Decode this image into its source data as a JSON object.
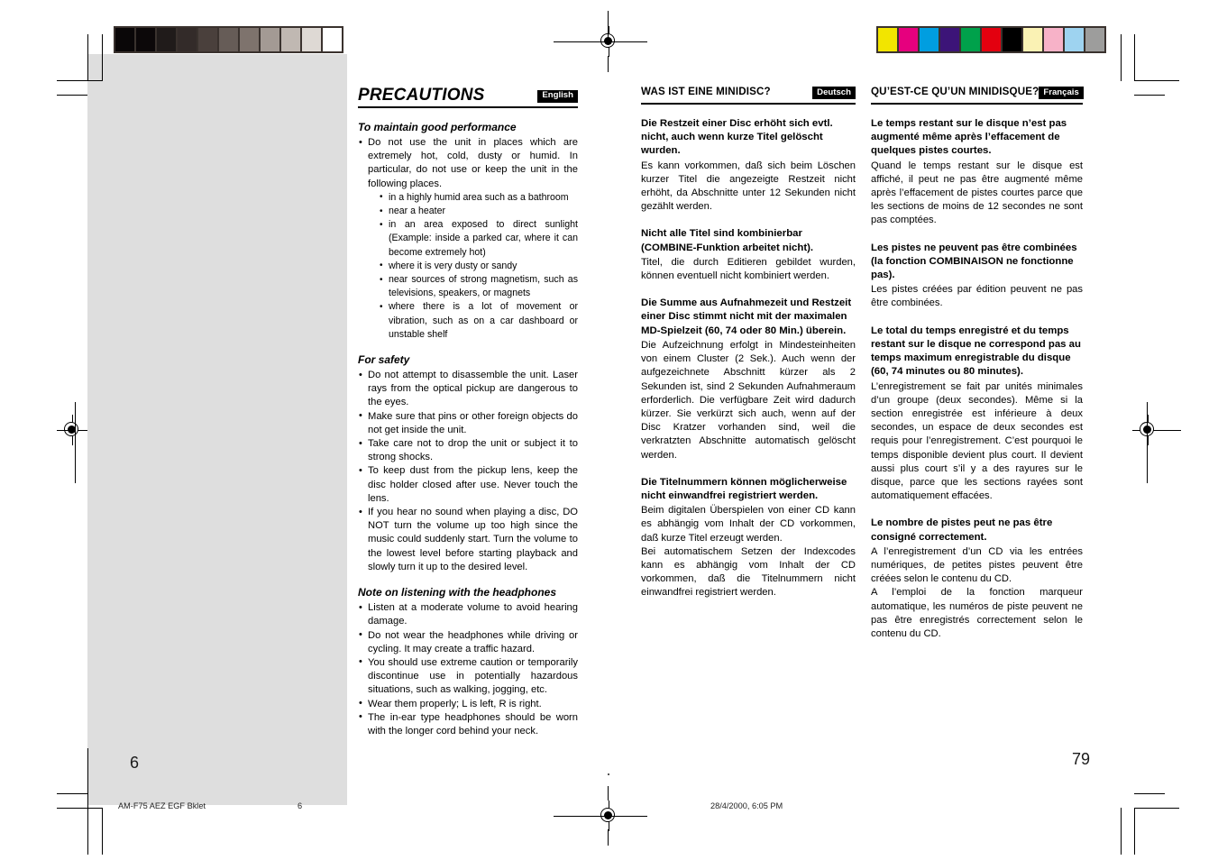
{
  "document": {
    "folio_left": "6",
    "folio_right": "79",
    "slug_name": "AM-F75 AEZ EGF Bklet",
    "slug_page": "6",
    "slug_date": "28/4/2000, 6:05 PM"
  },
  "colorbars": {
    "grayscale": [
      "#0a0708",
      "#0c0809",
      "#201b1a",
      "#332b29",
      "#4a403c",
      "#665c57",
      "#7e736d",
      "#a39a94",
      "#c0b8b2",
      "#ded9d4",
      "#ffffff"
    ],
    "process": [
      "#f2e500",
      "#e6007e",
      "#009ee0",
      "#3c1478",
      "#00a14b",
      "#e3000f",
      "#000000",
      "#faf2b4",
      "#f7b2c8",
      "#9ed3f0",
      "#9d9d9c"
    ]
  },
  "english": {
    "lang_tag": "English",
    "title": "PRECAUTIONS",
    "sections": [
      {
        "heading": "To maintain good performance",
        "items": [
          {
            "text": "Do not use the unit in places which are extremely hot, cold, dusty or humid.  In particular, do not use or keep the unit in the following places.",
            "subitems": [
              "in a highly humid area such as a bathroom",
              "near a heater",
              "in an area exposed to direct sunlight (Example: inside a parked car, where it can become extremely hot)",
              "where it is very dusty or sandy",
              "near sources of strong magnetism, such as televisions, speakers, or magnets",
              "where there is a lot of movement or vibration, such as on a car dashboard or unstable shelf"
            ]
          }
        ]
      },
      {
        "heading": "For safety",
        "items": [
          {
            "text": "Do not attempt to disassemble the unit. Laser rays from the optical pickup are dangerous to the eyes.",
            "subitems": []
          },
          {
            "text": "Make sure that pins or other foreign objects do not get inside the unit.",
            "subitems": []
          },
          {
            "text": "Take care not to drop the unit or subject it to strong shocks.",
            "subitems": []
          },
          {
            "text": "To keep dust from the pickup lens, keep the disc holder closed after use. Never touch the lens.",
            "subitems": []
          },
          {
            "text": "If you hear no sound when playing a disc, DO NOT turn the volume up too high since the music could suddenly start. Turn the volume to the lowest level before starting playback and slowly turn it up to the desired level.",
            "subitems": []
          }
        ]
      },
      {
        "heading": "Note on listening with the headphones",
        "items": [
          {
            "text": "Listen at a moderate volume to avoid hearing damage.",
            "subitems": []
          },
          {
            "text": "Do not wear the headphones while driving or cycling. It may create a traffic hazard.",
            "subitems": []
          },
          {
            "text": "You should use extreme caution or temporarily discontinue use in potentially hazardous situations, such as walking, jogging, etc.",
            "subitems": []
          },
          {
            "text": "Wear them properly; L is left, R is right.",
            "subitems": []
          },
          {
            "text": "The in-ear type headphones should be worn with the longer cord behind your neck.",
            "subitems": []
          }
        ]
      }
    ]
  },
  "deutsch": {
    "lang_tag": "Deutsch",
    "title": "WAS IST EINE MINIDISC?",
    "blocks": [
      {
        "heading": "Die Restzeit einer Disc erhöht sich evtl. nicht, auch wenn kurze Titel gelöscht wurden.",
        "paragraphs": [
          "Es kann vorkommen, daß sich beim Löschen kurzer Titel die angezeigte Restzeit nicht erhöht, da Abschnitte unter 12 Sekunden nicht gezählt werden."
        ]
      },
      {
        "heading": "Nicht alle Titel sind kombinierbar (COMBINE-Funktion arbeitet nicht).",
        "paragraphs": [
          "Titel, die durch Editieren gebildet wurden, können eventuell nicht kombiniert werden."
        ]
      },
      {
        "heading": "Die Summe aus Aufnahmezeit und Restzeit einer Disc stimmt nicht mit der maximalen MD-Spielzeit (60, 74 oder 80 Min.) überein.",
        "paragraphs": [
          "Die Aufzeichnung erfolgt in Mindesteinheiten von einem Cluster (2 Sek.). Auch wenn der aufgezeichnete Abschnitt kürzer als 2 Sekunden ist, sind 2 Sekunden Aufnahmeraum erforderlich. Die verfügbare Zeit wird dadurch kürzer. Sie verkürzt sich auch, wenn auf der Disc Kratzer vorhanden sind, weil die verkratzten Abschnitte automatisch gelöscht werden."
        ]
      },
      {
        "heading": "Die Titelnummern können möglicherweise nicht einwandfrei registriert werden.",
        "paragraphs": [
          "Beim digitalen Überspielen von einer CD kann es abhängig vom Inhalt der CD vorkommen, daß kurze Titel erzeugt werden.",
          "Bei automatischem Setzen der Indexcodes kann es abhängig vom Inhalt der CD vorkommen, daß die Titelnummern nicht einwandfrei registriert werden."
        ]
      }
    ]
  },
  "francais": {
    "lang_tag": "Français",
    "title": "QU’EST-CE QU’UN MINIDISQUE?",
    "blocks": [
      {
        "heading": "Le temps restant sur le disque n’est pas augmenté même après l’effacement de quelques pistes courtes.",
        "paragraphs": [
          "Quand le temps restant sur le disque est affiché, il peut ne pas être augmenté même après l’effacement de pistes courtes parce que les sections de moins de 12 secondes ne sont pas comptées."
        ]
      },
      {
        "heading": "Les pistes ne peuvent pas être combinées (la fonction COMBINAISON ne fonctionne pas).",
        "paragraphs": [
          "Les pistes créées par édition peuvent ne pas être combinées."
        ]
      },
      {
        "heading": "Le total du temps enregistré et du temps restant sur le disque ne correspond pas au temps maximum enregistrable du disque (60, 74 minutes ou 80 minutes).",
        "paragraphs": [
          "L’enregistrement se fait par unités minimales d’un groupe (deux secondes). Même si la section enregistrée est inférieure à deux secondes, un espace de deux secondes est requis pour l’enregistrement. C’est pourquoi le temps disponible devient plus court. Il devient aussi plus court s’il y a des rayures sur le disque, parce que les sections rayées sont automatiquement effacées."
        ]
      },
      {
        "heading": "Le nombre de pistes peut ne pas être consigné correctement.",
        "paragraphs": [
          "A l’enregistrement d’un CD via les entrées numériques, de petites pistes peuvent être créées selon le contenu du CD.",
          "A l’emploi de la fonction marqueur automatique, les numéros de piste peuvent ne pas être enregistrés correctement selon le contenu du CD."
        ]
      }
    ]
  }
}
